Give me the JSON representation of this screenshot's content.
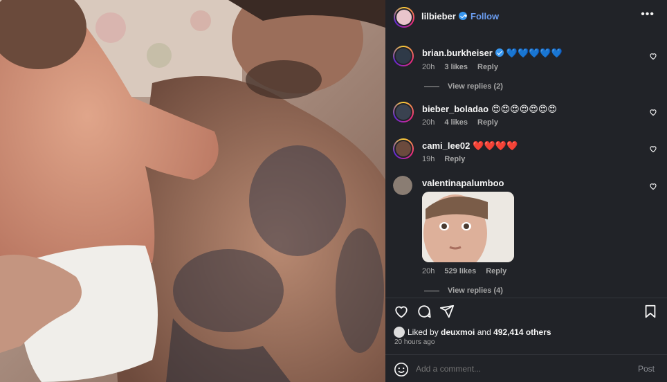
{
  "post": {
    "username": "lilbieber",
    "dot": "•",
    "follow_label": "Follow",
    "more_label": "•••"
  },
  "comments": [
    {
      "username": "brian.burkheiser",
      "text": "💙💙💙💙💙",
      "time": "20h",
      "likes": "3 likes",
      "reply_label": "Reply",
      "view_replies": "View replies (2)",
      "verified": true,
      "avatar_color": "#2f3a48"
    },
    {
      "username": "bieber_boladao",
      "text": "😍😍😍😍😍😍😍",
      "time": "20h",
      "likes": "4 likes",
      "reply_label": "Reply",
      "verified": false,
      "avatar_color": "#3a4250"
    },
    {
      "username": "cami_lee02",
      "text": "❤️❤️❤️❤️",
      "time": "19h",
      "reply_label": "Reply",
      "verified": false,
      "avatar_color": "#6b4a3d"
    },
    {
      "username": "valentinapalumboo",
      "text": "",
      "time": "20h",
      "likes": "529 likes",
      "reply_label": "Reply",
      "view_replies": "View replies (4)",
      "verified": false,
      "avatar_color": "#8a7d73"
    }
  ],
  "likes": {
    "liked_by_prefix": "Liked by",
    "liked_by_user": "deuxmoi",
    "and": "and",
    "count": "492,414 others",
    "time_ago": "20 hours ago"
  },
  "add_comment": {
    "placeholder": "Add a comment...",
    "post_label": "Post"
  },
  "icons": {
    "like": "heart-icon",
    "comment": "comment-icon",
    "share": "share-icon",
    "save": "bookmark-icon",
    "emoji": "emoji-icon",
    "more": "more-icon"
  },
  "colors": {
    "panel_bg": "#212328",
    "link_blue": "#6a9cf0",
    "verified_blue": "#3897f0",
    "muted_text": "#a8a8a8"
  }
}
